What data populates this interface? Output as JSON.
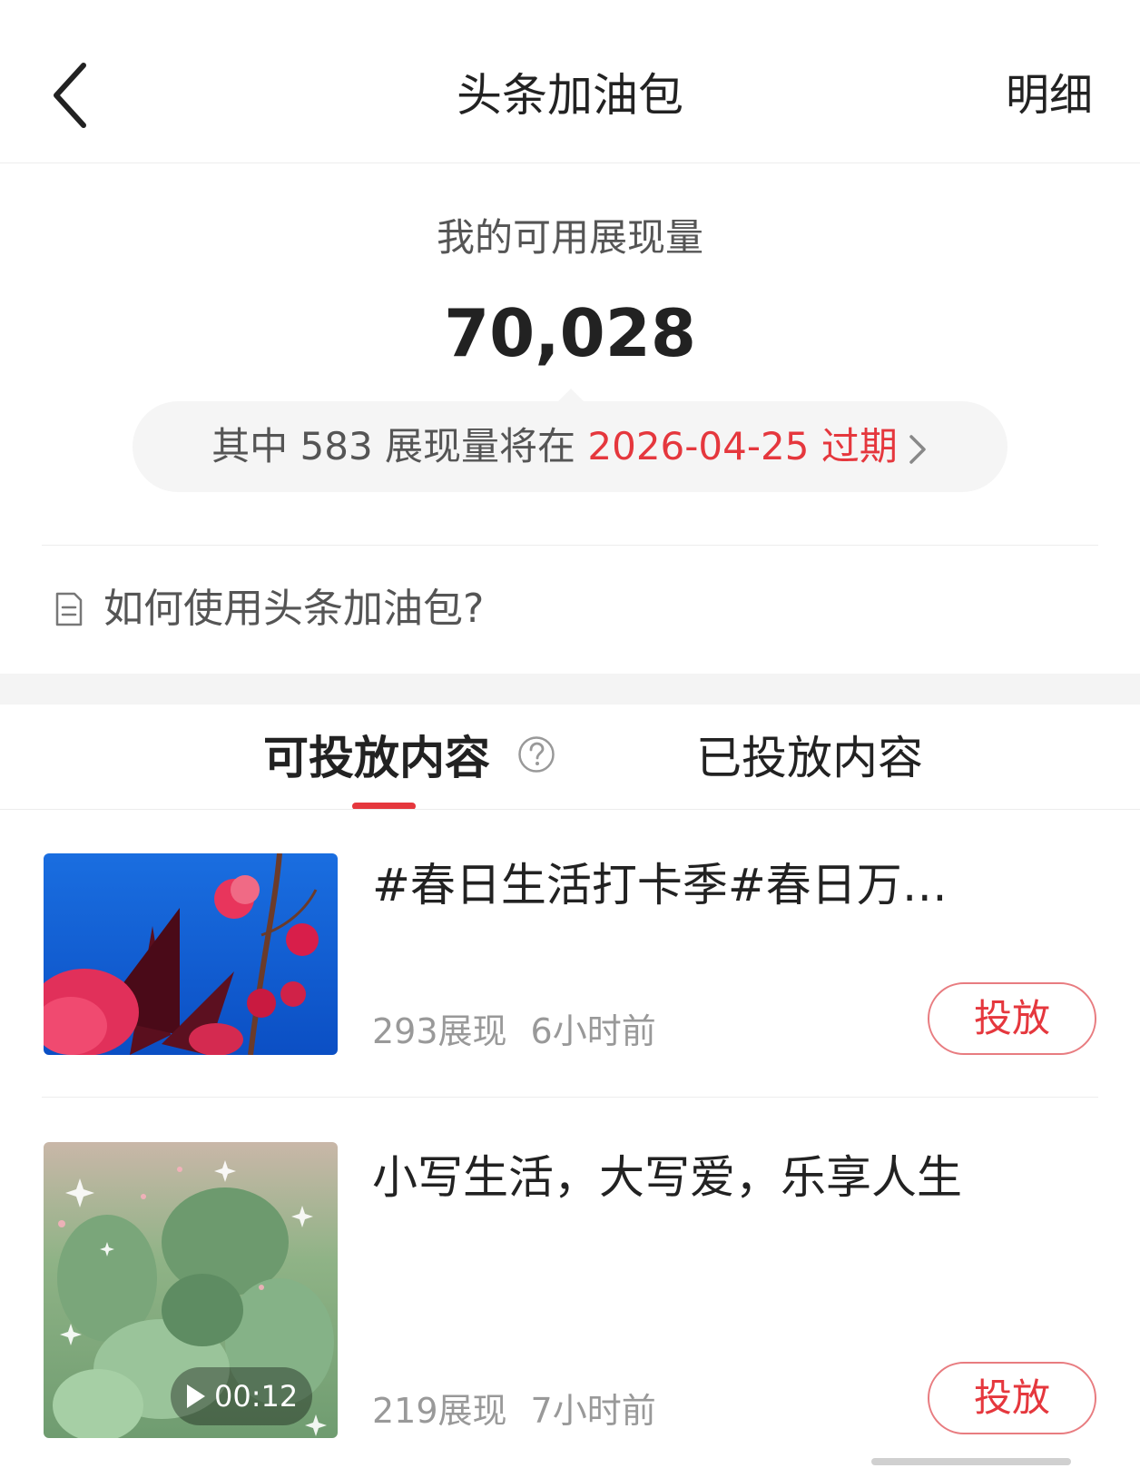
{
  "header": {
    "title": "头条加油包",
    "detail_label": "明细"
  },
  "summary": {
    "label": "我的可用展现量",
    "value": "70,028",
    "expiry_prefix": "其中 583 展现量将在 ",
    "expiry_date_label": "2026-04-25 过期"
  },
  "howto": {
    "text": "如何使用头条加油包?"
  },
  "tabs": [
    {
      "label": "可投放内容"
    },
    {
      "label": "已投放内容"
    }
  ],
  "items": [
    {
      "title": "#春日生活打卡季#春日万…",
      "impressions": "293展现",
      "time": "6小时前",
      "button_label": "投放"
    },
    {
      "title": "小写生活，大写爱，乐享人生",
      "impressions": "219展现",
      "time": "7小时前",
      "button_label": "投放",
      "duration": "00:12"
    }
  ],
  "colors": {
    "accent": "#e5373d",
    "button_border": "#e87c80"
  }
}
